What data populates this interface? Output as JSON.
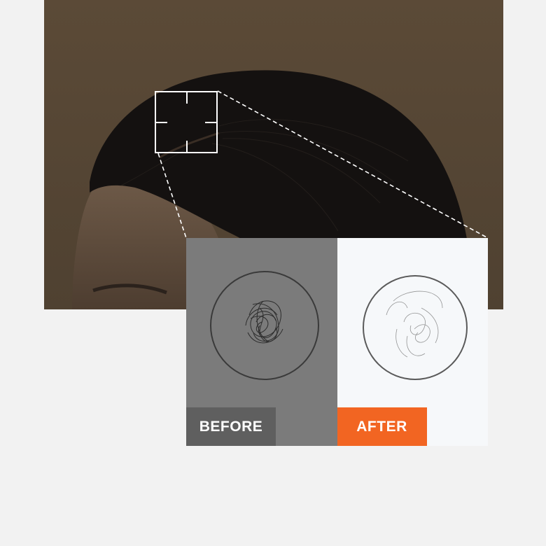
{
  "compare": {
    "before_label": "BEFORE",
    "after_label": "AFTER"
  },
  "colors": {
    "before_badge": "#5f5f5f",
    "after_badge": "#f26522",
    "backdrop": "#5a4a38",
    "page": "#f2f2f2"
  }
}
